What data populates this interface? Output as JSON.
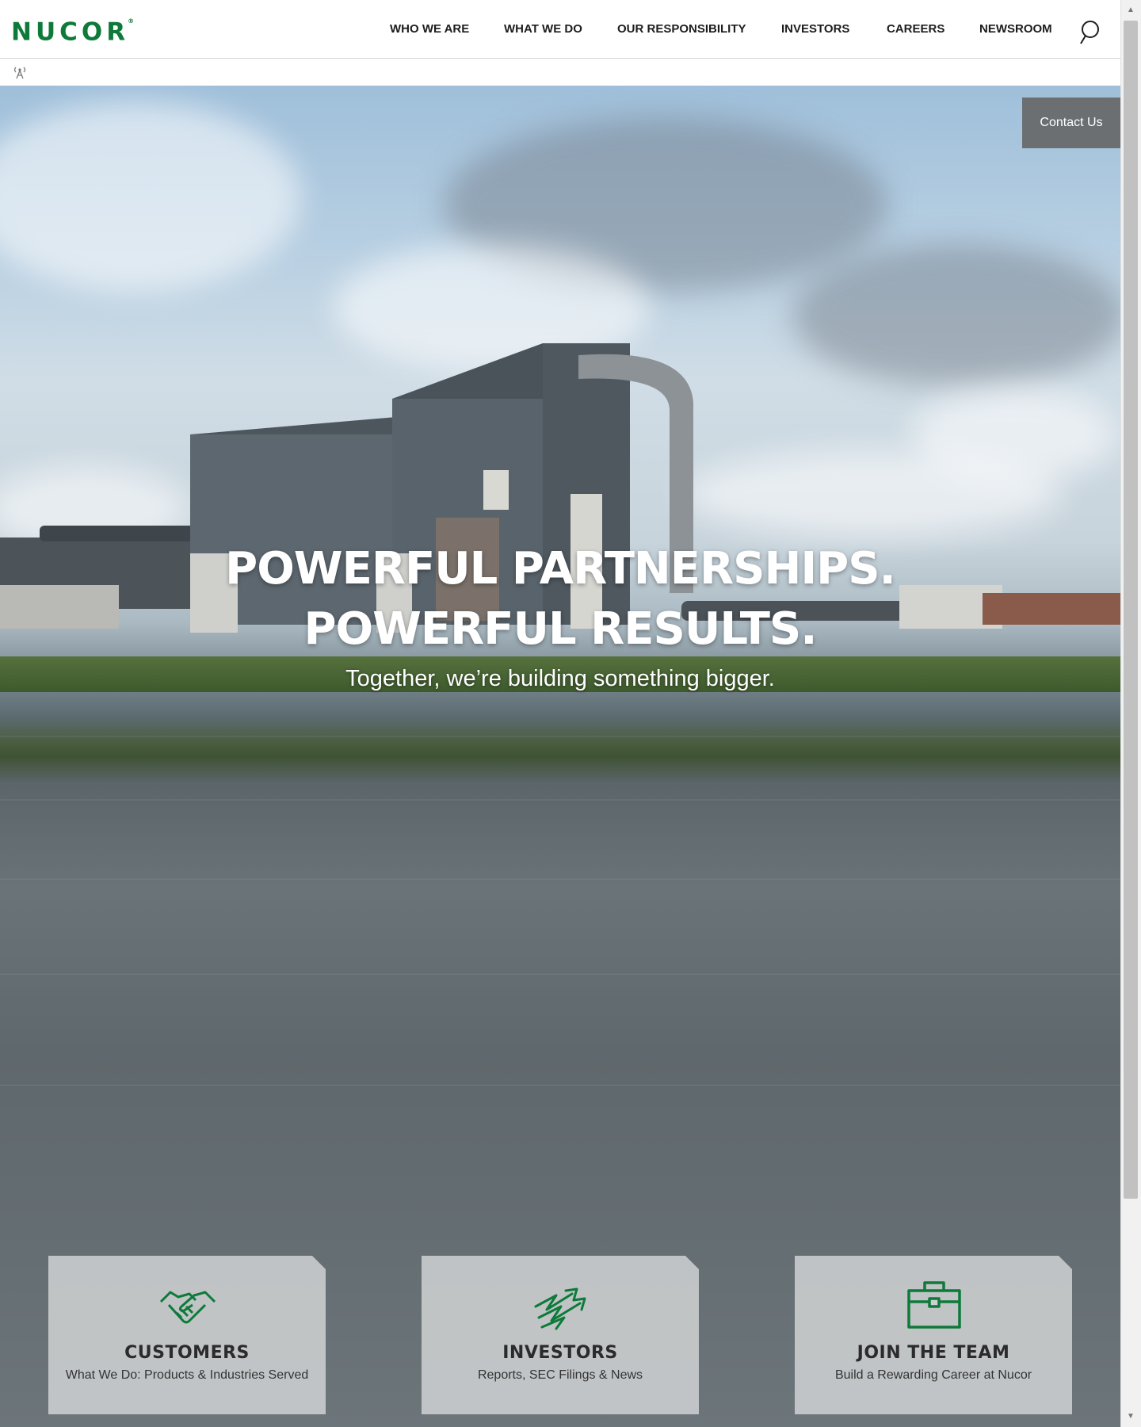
{
  "brand": {
    "name": "NUCOR",
    "mark": "®",
    "color": "#0e7a3a"
  },
  "nav": {
    "items": [
      {
        "label": "WHO WE ARE"
      },
      {
        "label": "WHAT WE DO"
      },
      {
        "label": "OUR RESPONSIBILITY"
      },
      {
        "label": "INVESTORS"
      },
      {
        "label": "CAREERS"
      },
      {
        "label": "NEWSROOM"
      }
    ],
    "search_icon": "search-icon"
  },
  "subbar": {
    "icon": "broadcast-icon"
  },
  "contact": {
    "label": "Contact Us"
  },
  "hero": {
    "title_line1": "POWERFUL PARTNERSHIPS.",
    "title_line2": "POWERFUL RESULTS.",
    "subtitle": "Together, we’re building something bigger."
  },
  "cards": [
    {
      "title": "CUSTOMERS",
      "subtitle": "What We Do: Products & Industries Served",
      "icon": "handshake-icon"
    },
    {
      "title": "INVESTORS",
      "subtitle": "Reports, SEC Filings & News",
      "icon": "growth-arrows-icon"
    },
    {
      "title": "JOIN THE TEAM",
      "subtitle": "Build a Rewarding Career at Nucor",
      "icon": "briefcase-icon"
    }
  ],
  "colors": {
    "accent": "#0e7a3a",
    "contact_bg": "#6b6f72"
  }
}
